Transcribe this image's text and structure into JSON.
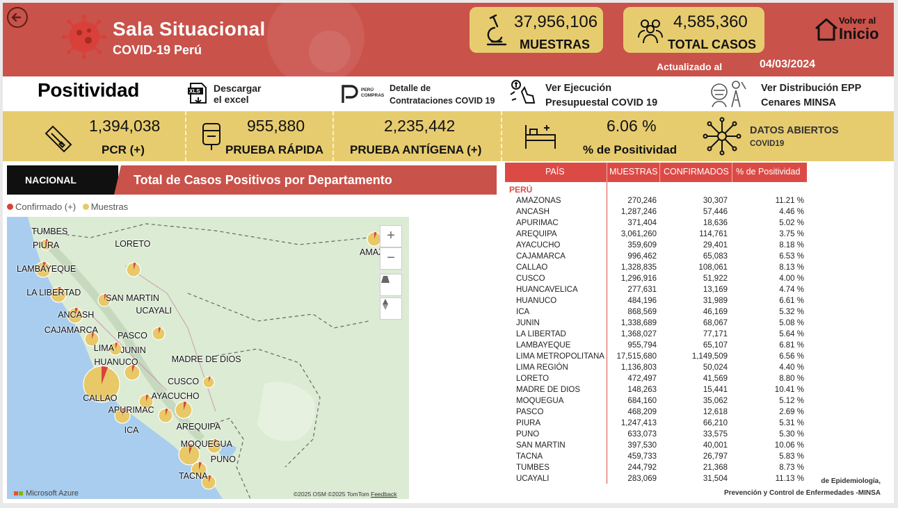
{
  "header": {
    "title": "Sala Situacional",
    "subtitle": "COVID-19 Perú",
    "kpis": [
      {
        "value": "37,956,106",
        "label": "MUESTRAS",
        "icon": "microscope-icon"
      },
      {
        "value": "4,585,360",
        "label": "TOTAL CASOS",
        "icon": "people-icon"
      }
    ],
    "home_line1": "Volver al",
    "home_line2": "Inicio",
    "updated_label": "Actualizado al",
    "updated_date": "04/03/2024"
  },
  "links": {
    "positividad": "Positividad",
    "download_line1": "Descargar",
    "download_line2": "el excel",
    "contracts_brand": "PERÚ COMPRAS",
    "contracts_line1": "Detalle de",
    "contracts_line2": "Contrataciones COVID 19",
    "budget_line1": "Ver Ejecución",
    "budget_line2": "Presupuestal COVID 19",
    "epp_line1": "Ver Distribución EPP",
    "epp_line2": "Cenares MINSA"
  },
  "stats": [
    {
      "value": "1,394,038",
      "label": "PCR (+)",
      "icon": "pcr-test-icon"
    },
    {
      "value": "955,880",
      "label": "PRUEBA RÁPIDA",
      "icon": "rapid-test-icon"
    },
    {
      "value": "2,235,442",
      "label": "PRUEBA ANTÍGENA (+)"
    },
    {
      "value": "6.06 %",
      "label": "% de Positividad",
      "icon": "hospital-bed-icon"
    }
  ],
  "open_data": {
    "title": "DATOS ABIERTOS",
    "subtitle": "COVID19",
    "icon": "network-icon"
  },
  "map": {
    "tab": "NACIONAL",
    "title": "Total de Casos Positivos por Departamento",
    "legend": [
      {
        "label": "Confirmado (+)",
        "color": "#d9423e"
      },
      {
        "label": "Muestras",
        "color": "#e8c867"
      }
    ],
    "labels": [
      "TUMBES",
      "PIURA",
      "LAMBAYEQUE",
      "LORETO",
      "LA LIBERTAD",
      "SAN MARTIN",
      "ANCASH",
      "UCAYALI",
      "CAJAMARCA",
      "PASCO",
      "LIMA",
      "JUNIN",
      "HUANUCO",
      "MADRE DE DIOS",
      "CUSCO",
      "CALLAO",
      "AYACUCHO",
      "APURIMAC",
      "ICA",
      "AREQUIPA",
      "MOQUEGUA",
      "PUNO",
      "TACNA",
      "AMAZO"
    ],
    "zoom_in": "+",
    "zoom_out": "−",
    "attribution": "©2025 OSM  ©2025 TomTom",
    "feedback": "Feedback",
    "azure": "Microsoft Azure",
    "colors": {
      "land": "#dcebd4",
      "sea": "#a8cdef",
      "bubble": "#e8c867",
      "confirmed": "#d9423e"
    }
  },
  "table": {
    "headers": [
      "PAÍS",
      "MUESTRAS",
      "CONFIRMADOS",
      "% de Positividad"
    ],
    "group": "PERÚ",
    "rows": [
      [
        "AMAZONAS",
        "270,246",
        "30,307",
        "11.21 %"
      ],
      [
        "ANCASH",
        "1,287,246",
        "57,446",
        "4.46 %"
      ],
      [
        "APURIMAC",
        "371,404",
        "18,636",
        "5.02 %"
      ],
      [
        "AREQUIPA",
        "3,061,260",
        "114,761",
        "3.75 %"
      ],
      [
        "AYACUCHO",
        "359,609",
        "29,401",
        "8.18 %"
      ],
      [
        "CAJAMARCA",
        "996,462",
        "65,083",
        "6.53 %"
      ],
      [
        "CALLAO",
        "1,328,835",
        "108,061",
        "8.13 %"
      ],
      [
        "CUSCO",
        "1,296,916",
        "51,922",
        "4.00 %"
      ],
      [
        "HUANCAVELICA",
        "277,631",
        "13,169",
        "4.74 %"
      ],
      [
        "HUANUCO",
        "484,196",
        "31,989",
        "6.61 %"
      ],
      [
        "ICA",
        "868,569",
        "46,169",
        "5.32 %"
      ],
      [
        "JUNIN",
        "1,338,689",
        "68,067",
        "5.08 %"
      ],
      [
        "LA LIBERTAD",
        "1,368,027",
        "77,171",
        "5.64 %"
      ],
      [
        "LAMBAYEQUE",
        "955,794",
        "65,107",
        "6.81 %"
      ],
      [
        "LIMA METROPOLITANA",
        "17,515,680",
        "1,149,509",
        "6.56 %"
      ],
      [
        "LIMA REGIÓN",
        "1,136,803",
        "50,024",
        "4.40 %"
      ],
      [
        "LORETO",
        "472,497",
        "41,569",
        "8.80 %"
      ],
      [
        "MADRE DE DIOS",
        "148,263",
        "15,441",
        "10.41 %"
      ],
      [
        "MOQUEGUA",
        "684,160",
        "35,062",
        "5.12 %"
      ],
      [
        "PASCO",
        "468,209",
        "12,618",
        "2.69 %"
      ],
      [
        "PIURA",
        "1,247,413",
        "66,210",
        "5.31 %"
      ],
      [
        "PUNO",
        "633,073",
        "33,575",
        "5.30 %"
      ],
      [
        "SAN MARTIN",
        "397,530",
        "40,001",
        "10.06 %"
      ],
      [
        "TACNA",
        "459,733",
        "26,797",
        "5.83 %"
      ],
      [
        "TUMBES",
        "244,792",
        "21,368",
        "8.73 %"
      ],
      [
        "UCAYALI",
        "283,069",
        "31,504",
        "11.13 %"
      ]
    ]
  },
  "footer": {
    "line1": "de Epidemiología,",
    "line2": "Prevención y Control de Enfermedades -MINSA"
  },
  "colors": {
    "header": "#c9524a",
    "band": "#e7cc6f",
    "table_head": "#dc4a45",
    "nacional": "#101010"
  }
}
